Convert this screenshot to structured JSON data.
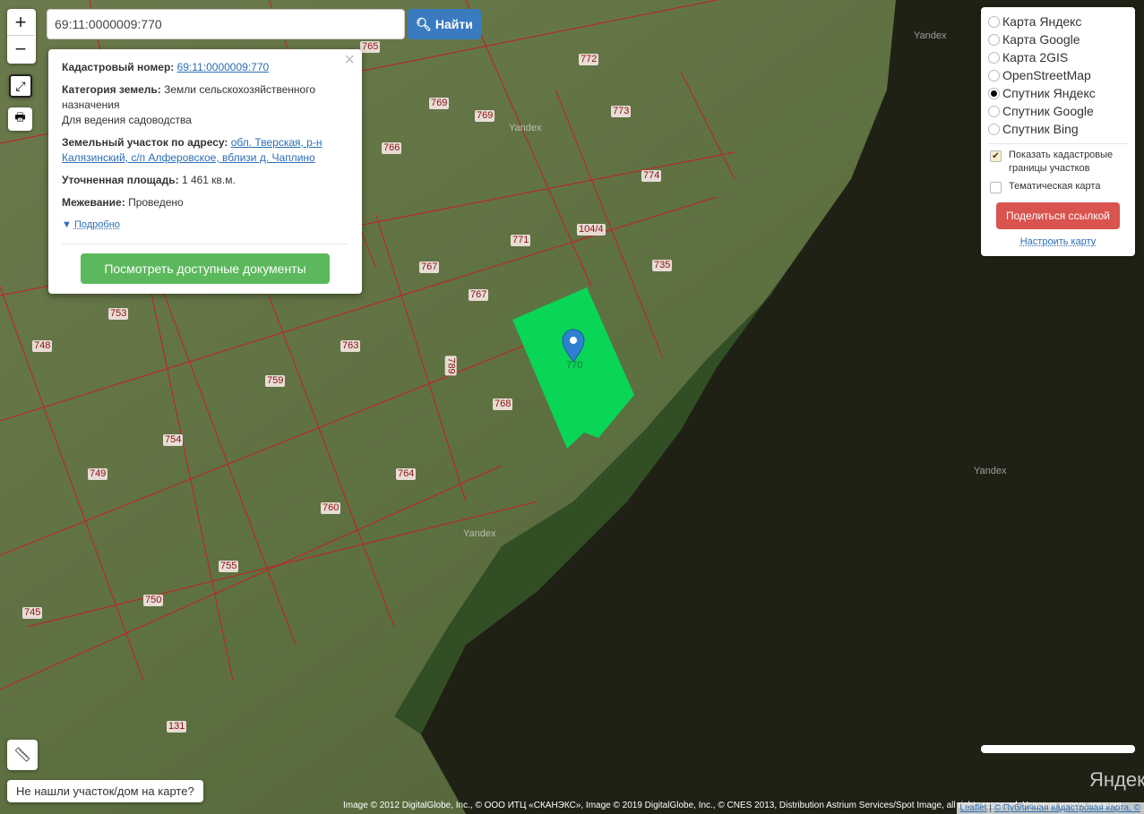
{
  "search": {
    "value": "69:11:0000009:770",
    "button": "Найти"
  },
  "zoom": {
    "in": "+",
    "out": "−"
  },
  "popup": {
    "cad_label": "Кадастровый номер:",
    "cad_value": "69:11:0000009:770",
    "cat_label": "Категория земель:",
    "cat_value": "Земли сельскохозяйственного назначения",
    "use": "Для ведения садоводства",
    "addr_label": "Земельный участок по адресу:",
    "addr_value": "обл. Тверская, р-н Калязинский, с/п Алферовское, вблизи д. Чаплино",
    "area_label": "Уточненная площадь:",
    "area_value": "1 461 кв.м.",
    "survey_label": "Межевание:",
    "survey_value": "Проведено",
    "more": "Подробно",
    "docs_button": "Посмотреть доступные документы"
  },
  "layers": {
    "options": [
      "Карта Яндекс",
      "Карта Google",
      "Карта 2GIS",
      "OpenStreetMap",
      "Спутник Яндекс",
      "Спутник Google",
      "Спутник Bing"
    ],
    "selected": "Спутник Яндекс",
    "show_borders": "Показать кадастровые границы участков",
    "thematic": "Тематическая карта",
    "share": "Поделиться ссылкой",
    "configure": "Настроить карту"
  },
  "parcel_labels": [
    "765",
    "772",
    "769",
    "769",
    "773",
    "766",
    "774",
    "104/4",
    "771",
    "735",
    "767",
    "767",
    "753",
    "748",
    "763",
    "789",
    "759",
    "768",
    "754",
    "749",
    "764",
    "760",
    "755",
    "750",
    "745",
    "131",
    "770"
  ],
  "watermarks": [
    "Yandex",
    "Yandex",
    "Yandex",
    "Yandex",
    "Яндекс"
  ],
  "not_found": "Не нашли участок/дом на карте?",
  "attribution": "Image © 2012 DigitalGlobe, Inc., © ООО ИТЦ «СКАНЭКС», Image © 2019 DigitalGlobe, Inc., © CNES 2013, Distribution Astrium Services/Spot Image, all rights reserved. Условия использования",
  "attribution2": {
    "leaflet": "Leaflet",
    "cadastre": "© Публичная кадастровая карта, ©"
  }
}
